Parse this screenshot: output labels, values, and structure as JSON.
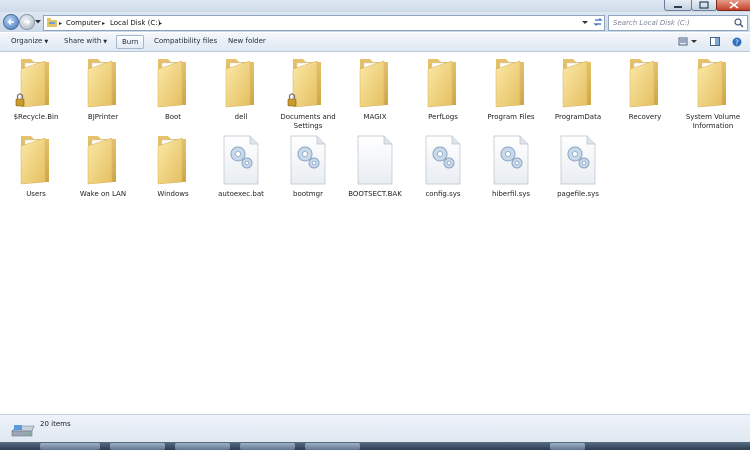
{
  "window": {
    "controls": [
      "minimize-button",
      "maximize-button",
      "close-button"
    ]
  },
  "address_bar": {
    "crumbs": [
      "Computer",
      "Local Disk (C:)"
    ]
  },
  "search": {
    "placeholder": "Search Local Disk (C:)"
  },
  "toolbar": {
    "organize": "Organize",
    "share_with": "Share with",
    "burn": "Burn",
    "compatibility": "Compatibility files",
    "new_folder": "New folder"
  },
  "items": [
    {
      "name": "$Recycle.Bin",
      "type": "folder",
      "locked": true
    },
    {
      "name": "BJPrinter",
      "type": "folder"
    },
    {
      "name": "Boot",
      "type": "folder"
    },
    {
      "name": "dell",
      "type": "folder"
    },
    {
      "name": "Documents and Settings",
      "type": "folder",
      "locked": true
    },
    {
      "name": "MAGIX",
      "type": "folder"
    },
    {
      "name": "PerfLogs",
      "type": "folder"
    },
    {
      "name": "Program Files",
      "type": "folder"
    },
    {
      "name": "ProgramData",
      "type": "folder"
    },
    {
      "name": "Recovery",
      "type": "folder"
    },
    {
      "name": "System Volume Information",
      "type": "folder"
    },
    {
      "name": "Users",
      "type": "folder"
    },
    {
      "name": "Wake on LAN",
      "type": "folder"
    },
    {
      "name": "Windows",
      "type": "folder"
    },
    {
      "name": "autoexec.bat",
      "type": "system-file"
    },
    {
      "name": "bootmgr",
      "type": "system-file"
    },
    {
      "name": "BOOTSECT.BAK",
      "type": "blank-file"
    },
    {
      "name": "config.sys",
      "type": "system-file"
    },
    {
      "name": "hiberfil.sys",
      "type": "system-file"
    },
    {
      "name": "pagefile.sys",
      "type": "system-file"
    }
  ],
  "status": {
    "count": "20 items"
  },
  "colors": {
    "folder": "#f2d27a",
    "folder_dark": "#d9ae4a",
    "accent": "#3d74bd"
  }
}
